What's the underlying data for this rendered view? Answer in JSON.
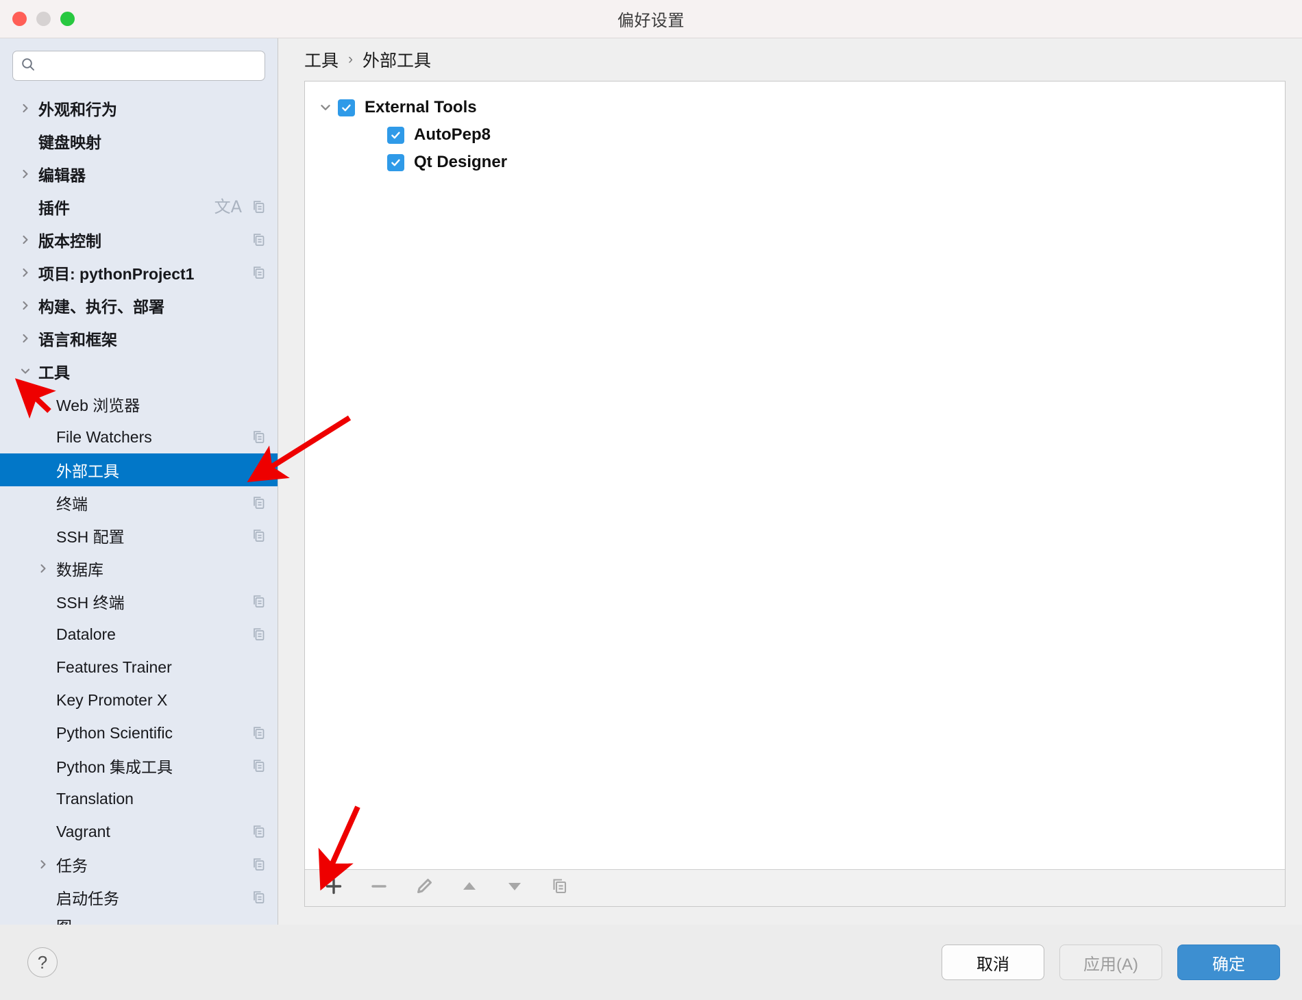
{
  "window": {
    "title": "偏好设置",
    "traffic_lights": [
      "close-red",
      "minimize-yellow",
      "zoom-green"
    ]
  },
  "sidebar": {
    "search": {
      "value": "",
      "placeholder": ""
    },
    "items": [
      {
        "label": "外观和行为",
        "level": 0,
        "twisty": "right",
        "bold": true,
        "selected": false,
        "trail": []
      },
      {
        "label": "键盘映射",
        "level": 0,
        "twisty": "none",
        "bold": true,
        "selected": false,
        "trail": []
      },
      {
        "label": "编辑器",
        "level": 0,
        "twisty": "right",
        "bold": true,
        "selected": false,
        "trail": []
      },
      {
        "label": "插件",
        "level": 0,
        "twisty": "none",
        "bold": true,
        "selected": false,
        "trail": [
          "translate-icon",
          "copy-icon"
        ]
      },
      {
        "label": "版本控制",
        "level": 0,
        "twisty": "right",
        "bold": true,
        "selected": false,
        "trail": [
          "copy-icon"
        ]
      },
      {
        "label": "项目: pythonProject1",
        "level": 0,
        "twisty": "right",
        "bold": true,
        "selected": false,
        "trail": [
          "copy-icon"
        ]
      },
      {
        "label": "构建、执行、部署",
        "level": 0,
        "twisty": "right",
        "bold": true,
        "selected": false,
        "trail": []
      },
      {
        "label": "语言和框架",
        "level": 0,
        "twisty": "right",
        "bold": true,
        "selected": false,
        "trail": []
      },
      {
        "label": "工具",
        "level": 0,
        "twisty": "down",
        "bold": true,
        "selected": false,
        "trail": []
      },
      {
        "label": "Web 浏览器",
        "level": 1,
        "twisty": "none",
        "bold": false,
        "selected": false,
        "trail": []
      },
      {
        "label": "File Watchers",
        "level": 1,
        "twisty": "none",
        "bold": false,
        "selected": false,
        "trail": [
          "copy-icon"
        ]
      },
      {
        "label": "外部工具",
        "level": 1,
        "twisty": "none",
        "bold": false,
        "selected": true,
        "trail": []
      },
      {
        "label": "终端",
        "level": 1,
        "twisty": "none",
        "bold": false,
        "selected": false,
        "trail": [
          "copy-icon"
        ]
      },
      {
        "label": "SSH 配置",
        "level": 1,
        "twisty": "none",
        "bold": false,
        "selected": false,
        "trail": [
          "copy-icon"
        ]
      },
      {
        "label": "数据库",
        "level": 1,
        "twisty": "right",
        "bold": false,
        "selected": false,
        "trail": []
      },
      {
        "label": "SSH 终端",
        "level": 1,
        "twisty": "none",
        "bold": false,
        "selected": false,
        "trail": [
          "copy-icon"
        ]
      },
      {
        "label": "Datalore",
        "level": 1,
        "twisty": "none",
        "bold": false,
        "selected": false,
        "trail": [
          "copy-icon"
        ]
      },
      {
        "label": "Features Trainer",
        "level": 1,
        "twisty": "none",
        "bold": false,
        "selected": false,
        "trail": []
      },
      {
        "label": "Key Promoter X",
        "level": 1,
        "twisty": "none",
        "bold": false,
        "selected": false,
        "trail": []
      },
      {
        "label": "Python Scientific",
        "level": 1,
        "twisty": "none",
        "bold": false,
        "selected": false,
        "trail": [
          "copy-icon"
        ]
      },
      {
        "label": "Python 集成工具",
        "level": 1,
        "twisty": "none",
        "bold": false,
        "selected": false,
        "trail": [
          "copy-icon"
        ]
      },
      {
        "label": "Translation",
        "level": 1,
        "twisty": "none",
        "bold": false,
        "selected": false,
        "trail": []
      },
      {
        "label": "Vagrant",
        "level": 1,
        "twisty": "none",
        "bold": false,
        "selected": false,
        "trail": [
          "copy-icon"
        ]
      },
      {
        "label": "任务",
        "level": 1,
        "twisty": "right",
        "bold": false,
        "selected": false,
        "trail": [
          "copy-icon"
        ]
      },
      {
        "label": "启动任务",
        "level": 1,
        "twisty": "none",
        "bold": false,
        "selected": false,
        "trail": [
          "copy-icon"
        ]
      },
      {
        "label": "图",
        "level": 1,
        "twisty": "none",
        "bold": false,
        "selected": false,
        "trail": [],
        "clipped": true
      }
    ]
  },
  "breadcrumb": {
    "parent": "工具",
    "separator": "›",
    "current": "外部工具"
  },
  "main": {
    "tree": [
      {
        "label": "External Tools",
        "level": 0,
        "checked": true,
        "twisty": "down"
      },
      {
        "label": "AutoPep8",
        "level": 1,
        "checked": true,
        "twisty": "none"
      },
      {
        "label": "Qt Designer",
        "level": 1,
        "checked": true,
        "twisty": "none"
      }
    ],
    "toolbar": [
      {
        "name": "add-button",
        "icon": "plus-icon",
        "enabled": true
      },
      {
        "name": "remove-button",
        "icon": "minus-icon",
        "enabled": false
      },
      {
        "name": "edit-button",
        "icon": "pencil-icon",
        "enabled": false
      },
      {
        "name": "move-up-button",
        "icon": "arrow-up-icon",
        "enabled": false
      },
      {
        "name": "move-down-button",
        "icon": "arrow-down-icon",
        "enabled": false
      },
      {
        "name": "copy-button",
        "icon": "copy-icon",
        "enabled": false
      }
    ]
  },
  "footer": {
    "help_label": "?",
    "cancel_label": "取消",
    "apply_label": "应用(A)",
    "ok_label": "确定"
  },
  "colors": {
    "selection_blue": "#0277c8",
    "checkbox_blue": "#2f9ae8",
    "primary_button_blue": "#3d8fd1",
    "sidebar_bg": "#e4e9f2",
    "annotation_red": "#ee0000"
  },
  "annotations": [
    {
      "name": "arrow-to-tools",
      "type": "red-arrow",
      "points_to": "工具"
    },
    {
      "name": "arrow-to-external-tools",
      "type": "red-arrow",
      "points_to": "外部工具"
    },
    {
      "name": "arrow-to-add-button",
      "type": "red-arrow",
      "points_to": "add-button"
    }
  ]
}
